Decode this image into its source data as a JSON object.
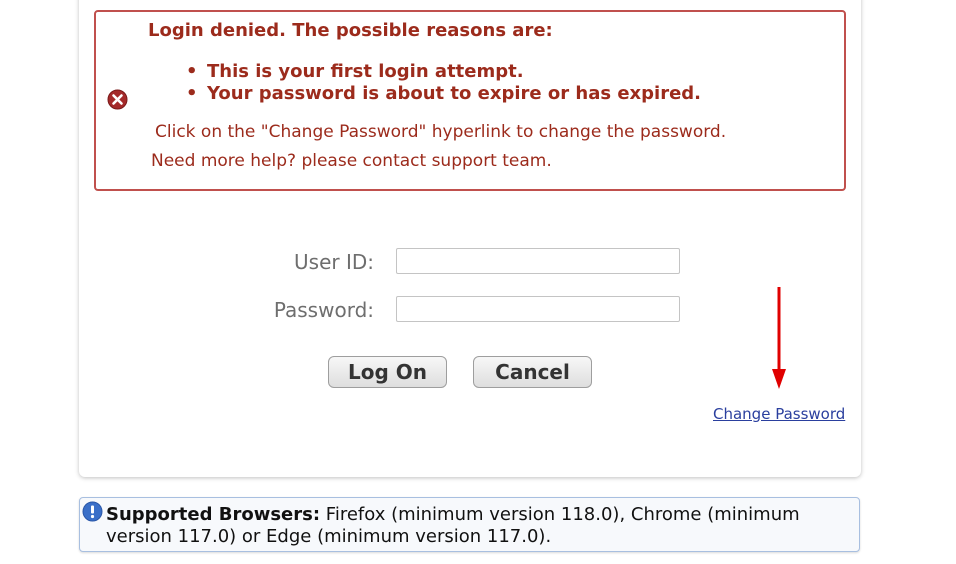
{
  "error": {
    "title": "Login denied. The possible reasons are:",
    "bullet": "•",
    "reasons": [
      "This is your first login attempt.",
      "Your password is about to expire or has expired."
    ],
    "help_lines": [
      "Click on the \"Change Password\" hyperlink to change the password.",
      "Need more help? please contact support team."
    ],
    "icon": "error-x-icon"
  },
  "form": {
    "userid_label": "User ID:",
    "userid_value": "",
    "password_label": "Password:",
    "password_value": "",
    "logon_label": "Log On",
    "cancel_label": "Cancel",
    "change_password_label": "Change Password"
  },
  "info": {
    "heading": "Supported Browsers:",
    "text": " Firefox (minimum version 118.0), Chrome (minimum version 117.0) or Edge (minimum version 117.0).",
    "icon": "info-exclamation-icon"
  },
  "colors": {
    "error_text": "#9c2b1c",
    "error_border": "#c0504d",
    "link": "#2a3f9e",
    "annotation_arrow": "#e00000",
    "info_icon": "#3a6fc8"
  }
}
